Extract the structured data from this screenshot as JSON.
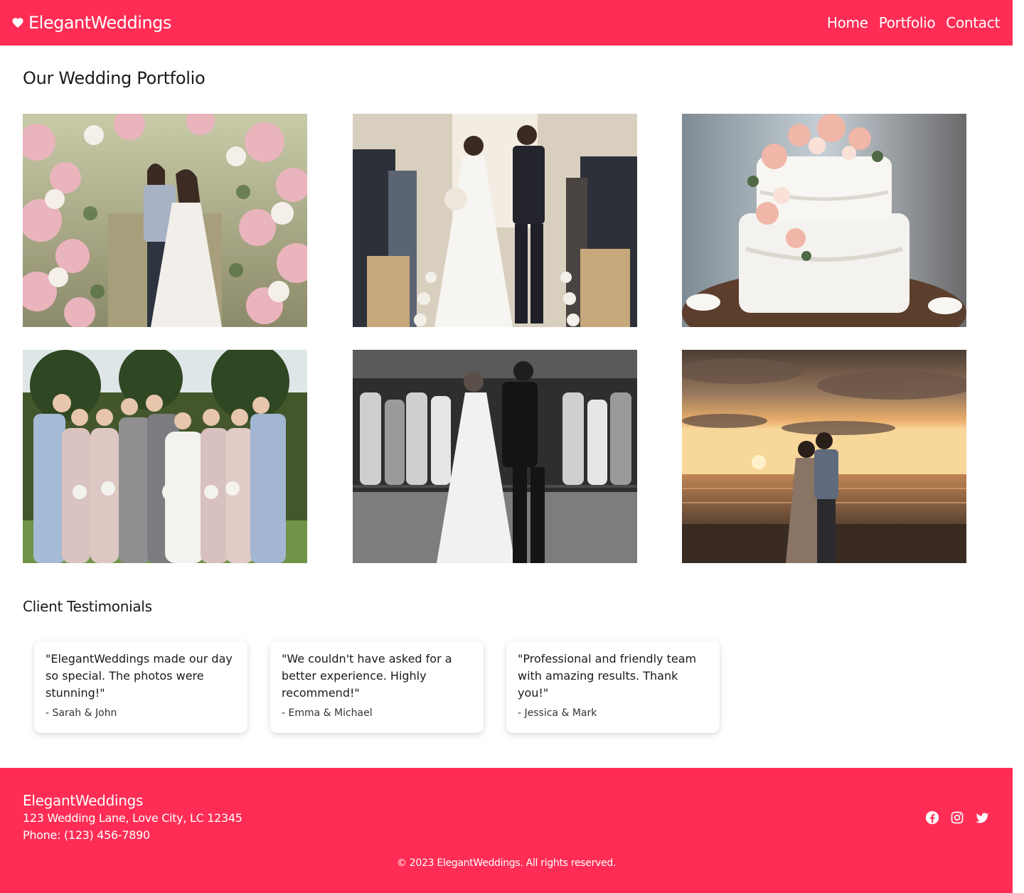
{
  "header": {
    "brand": "ElegantWeddings",
    "nav": [
      "Home",
      "Portfolio",
      "Contact"
    ]
  },
  "portfolio": {
    "title": "Our Wedding Portfolio",
    "photos": [
      "couple-under-floral-arch",
      "couple-walking-down-aisle",
      "wedding-cake-with-flowers",
      "bridal-party-group",
      "first-dance-black-and-white",
      "couple-at-sunset-beach"
    ]
  },
  "testimonials": {
    "title": "Client Testimonials",
    "items": [
      {
        "quote": "\"ElegantWeddings made our day so special. The photos were stunning!\"",
        "author": "- Sarah & John"
      },
      {
        "quote": "\"We couldn't have asked for a better experience. Highly recommend!\"",
        "author": "- Emma & Michael"
      },
      {
        "quote": "\"Professional and friendly team with amazing results. Thank you!\"",
        "author": "- Jessica & Mark"
      }
    ]
  },
  "footer": {
    "brand": "ElegantWeddings",
    "address": "123 Wedding Lane, Love City, LC 12345",
    "phone": "Phone: (123) 456-7890",
    "socials": [
      "facebook-icon",
      "instagram-icon",
      "twitter-icon"
    ],
    "copyright": "© 2023 ElegantWeddings. All rights reserved."
  },
  "colors": {
    "brand": "#ff2d55",
    "text": "#1a1a1a",
    "background": "#ffffff"
  }
}
